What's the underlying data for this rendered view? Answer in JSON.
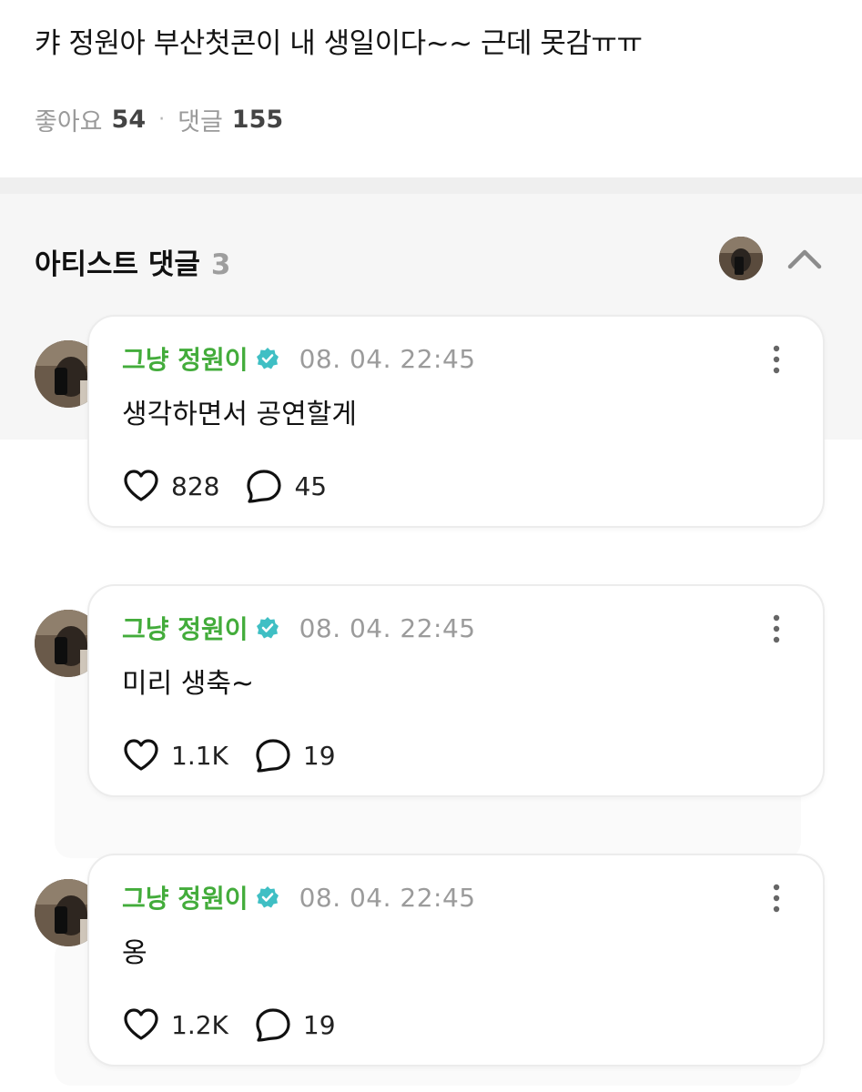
{
  "post": {
    "title": "캬 정원아 부산첫콘이 내 생일이다~~ 근데 못감ㅠㅠ",
    "likes_label": "좋아요",
    "likes": "54",
    "separator": "·",
    "comments_label": "댓글",
    "comments": "155"
  },
  "artist_comments": {
    "title": "아티스트 댓글",
    "count": "3",
    "items": [
      {
        "author": "그냥 정원이",
        "time": "08. 04. 22:45",
        "text": "생각하면서 공연할게",
        "likes": "828",
        "replies": "45"
      },
      {
        "author": "그냥 정원이",
        "time": "08. 04. 22:45",
        "text": "미리 생축~",
        "likes": "1.1K",
        "replies": "19"
      },
      {
        "author": "그냥 정원이",
        "time": "08. 04. 22:45",
        "text": "옹",
        "likes": "1.2K",
        "replies": "19"
      }
    ]
  },
  "colors": {
    "author_green": "#43ac3b",
    "verified_teal": "#3fbfc4",
    "muted_gray": "#9b9b9b"
  },
  "icons": {
    "verified": "verified-badge-icon",
    "more": "kebab-menu-icon",
    "like": "heart-icon",
    "reply": "speech-bubble-icon",
    "collapse": "chevron-up-icon"
  }
}
